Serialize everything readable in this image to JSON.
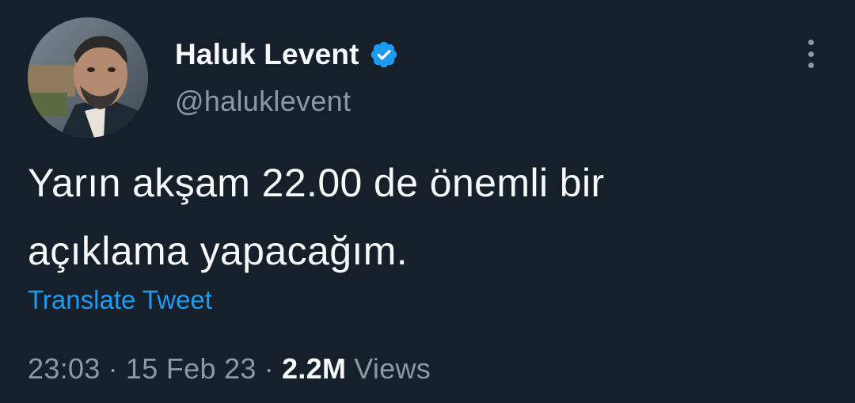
{
  "author": {
    "display_name": "Haluk Levent",
    "handle": "@haluklevent",
    "verified": true,
    "verified_icon": "verified-badge-icon"
  },
  "menu_icon": "more-vertical-icon",
  "tweet": {
    "text_line_1": "Yarın akşam 22.00 de önemli bir",
    "text_line_2": "açıklama yapacağım."
  },
  "translate_label": "Translate Tweet",
  "meta": {
    "time": "23:03",
    "separator": "·",
    "date": "15 Feb 23",
    "views_count": "2.2M",
    "views_label": "Views"
  },
  "colors": {
    "background": "#16202b",
    "text": "#f7f9f9",
    "secondary_text": "#8b98a5",
    "accent": "#1d9bf0"
  }
}
